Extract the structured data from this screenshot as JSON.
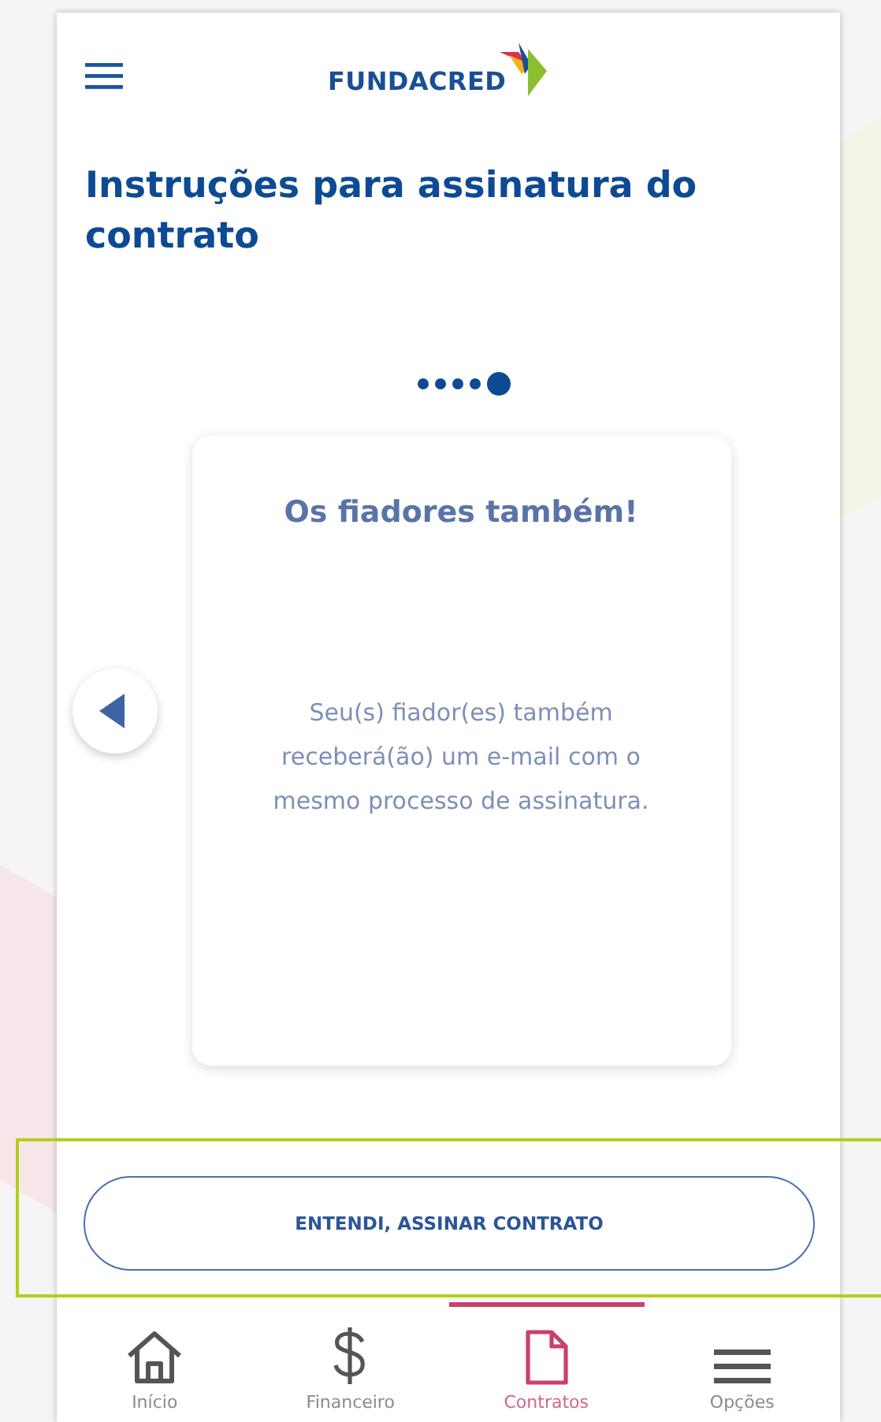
{
  "header": {
    "brand": "FUNDACRED"
  },
  "title": "Instruções para assinatura do contrato",
  "steps": [
    {
      "selected": false
    },
    {
      "selected": false
    },
    {
      "selected": false
    },
    {
      "selected": false
    },
    {
      "selected": true
    }
  ],
  "card": {
    "heading": "Os fiadores também!",
    "text": "Seu(s) fiador(es) também receberá(ão) um e-mail com o mesmo processo de assinatura."
  },
  "primary_button": "ENTENDI, ASSINAR CONTRATO",
  "bottom_nav": [
    {
      "kind": "home",
      "label": "Início",
      "selected": false
    },
    {
      "kind": "money",
      "label": "Financeiro",
      "selected": false
    },
    {
      "kind": "document",
      "label": "Contratos",
      "selected": true
    },
    {
      "kind": "menu",
      "label": "Opções",
      "selected": false
    }
  ]
}
